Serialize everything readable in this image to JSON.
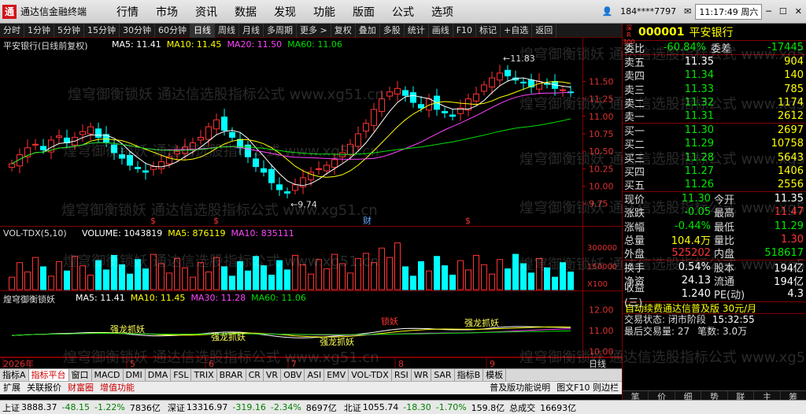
{
  "titlebar": {
    "logo": "通",
    "app_name": "通达信金融终端",
    "menus": [
      "行情",
      "市场",
      "资讯",
      "数据",
      "发现",
      "功能",
      "版面",
      "公式",
      "选项"
    ],
    "user": "184****7797",
    "clock": "11:17:49 周六"
  },
  "toolbar": {
    "items": [
      "分时",
      "1分钟",
      "5分钟",
      "15分钟",
      "30分钟",
      "60分钟",
      "日线",
      "周线",
      "月线",
      "多周期",
      "更多 >",
      "复权",
      "叠加",
      "多股",
      "统计",
      "画线",
      "F10",
      "标记",
      "+自选",
      "返回"
    ],
    "active": "日线"
  },
  "chart": {
    "title": "平安银行(日线前复权)",
    "ma_labels": [
      {
        "text": "MA5: 11.41",
        "color": "#ffffff"
      },
      {
        "text": "MA10: 11.45",
        "color": "#ffff00"
      },
      {
        "text": "MA20: 11.50",
        "color": "#ff44ff"
      },
      {
        "text": "MA60: 11.06",
        "color": "#00dd00"
      }
    ],
    "high_label": "11.83",
    "low_label": "9.74",
    "price_ticks": [
      "11.50",
      "11.25",
      "11.00",
      "10.75",
      "10.50",
      "10.25",
      "10.00",
      "9.75"
    ],
    "events": [
      "$",
      "$",
      "财",
      "$"
    ],
    "vol_title": "VOL-TDX(5,10)",
    "vol_labels": [
      {
        "text": "VOLUME: 1043819",
        "color": "#ffffff"
      },
      {
        "text": "MA5: 876119",
        "color": "#ffff00"
      },
      {
        "text": "MA10: 835111",
        "color": "#ff44ff"
      }
    ],
    "vol_ticks": [
      "300000",
      "150000",
      "X100"
    ],
    "ind_title": "煌穹御衡锁妖",
    "ind_labels": [
      {
        "text": "MA5: 11.41",
        "color": "#ffffff"
      },
      {
        "text": "MA10: 11.45",
        "color": "#ffff00"
      },
      {
        "text": "MA30: 11.28",
        "color": "#ff44ff"
      },
      {
        "text": "MA60: 11.06",
        "color": "#00dd00"
      }
    ],
    "ind_ticks": [
      "12.00",
      "11.00",
      "10.00"
    ],
    "signals": [
      {
        "text": "强龙抓妖",
        "color": "#ffff55"
      },
      {
        "text": "强龙抓妖",
        "color": "#ffff55"
      },
      {
        "text": "强龙抓妖",
        "color": "#ffff55"
      },
      {
        "text": "锁妖",
        "color": "#ff3333"
      },
      {
        "text": "强龙抓妖",
        "color": "#ffff55"
      }
    ],
    "dates": [
      "2026年",
      "5",
      "6",
      "7",
      "8",
      "9"
    ],
    "date_right": "日线"
  },
  "chart_data": {
    "type": "candlestick",
    "title": "平安银行(日线前复权)",
    "ylim": [
      9.6,
      11.9
    ],
    "high": 11.83,
    "low": 9.74,
    "close_path": [
      10.32,
      10.45,
      10.55,
      10.6,
      10.52,
      10.66,
      10.72,
      10.62,
      10.7,
      10.78,
      10.85,
      10.7,
      10.62,
      10.48,
      10.4,
      10.3,
      10.25,
      10.2,
      10.28,
      10.35,
      10.42,
      10.5,
      10.56,
      10.62,
      10.7,
      10.85,
      10.95,
      10.8,
      10.7,
      10.55,
      10.42,
      10.28,
      10.2,
      10.05,
      9.95,
      9.9,
      10.02,
      10.12,
      10.2,
      10.25,
      10.3,
      10.38,
      10.48,
      10.6,
      10.75,
      10.9,
      11.1,
      11.25,
      11.35,
      11.4,
      11.3,
      11.2,
      11.12,
      11.25,
      11.1,
      11.05,
      11.0,
      11.12,
      11.25,
      11.32,
      11.45,
      11.55,
      11.62,
      11.58,
      11.52,
      11.48,
      11.42,
      11.5,
      11.46,
      11.4,
      11.38,
      11.35
    ],
    "ma5": 11.41,
    "ma10": 11.45,
    "ma20": 11.5,
    "ma60": 11.06,
    "volume": 1043819,
    "vol_ma5": 876119,
    "vol_ma10": 835111
  },
  "quote": {
    "market": [
      "深",
      "R",
      "300"
    ],
    "code": "000001",
    "name": "平安银行",
    "ratio": {
      "label": "委比",
      "pct": "-60.84%",
      "diff_label": "委差",
      "diff": "-17445"
    },
    "asks": [
      {
        "label": "卖五",
        "price": "11.35",
        "vol": "904",
        "pcolor": "white"
      },
      {
        "label": "卖四",
        "price": "11.34",
        "vol": "140",
        "pcolor": "green"
      },
      {
        "label": "卖三",
        "price": "11.33",
        "vol": "785",
        "pcolor": "green"
      },
      {
        "label": "卖二",
        "price": "11.32",
        "vol": "1174",
        "pcolor": "green"
      },
      {
        "label": "卖一",
        "price": "11.31",
        "vol": "2612",
        "pcolor": "green"
      }
    ],
    "bids": [
      {
        "label": "买一",
        "price": "11.30",
        "vol": "2697",
        "pcolor": "green"
      },
      {
        "label": "买二",
        "price": "11.29",
        "vol": "10758",
        "pcolor": "green"
      },
      {
        "label": "买三",
        "price": "11.28",
        "vol": "5643",
        "pcolor": "green"
      },
      {
        "label": "买四",
        "price": "11.27",
        "vol": "1406",
        "pcolor": "green"
      },
      {
        "label": "买五",
        "price": "11.26",
        "vol": "2556",
        "pcolor": "green"
      }
    ],
    "stats": [
      {
        "l1": "现价",
        "v1": "11.30",
        "c1": "green",
        "l2": "今开",
        "v2": "11.35",
        "c2": "white"
      },
      {
        "l1": "涨跌",
        "v1": "-0.05",
        "c1": "green",
        "l2": "最高",
        "v2": "11.47",
        "c2": "red"
      },
      {
        "l1": "涨幅",
        "v1": "-0.44%",
        "c1": "green",
        "l2": "最低",
        "v2": "11.29",
        "c2": "green"
      },
      {
        "l1": "总量",
        "v1": "104.4万",
        "c1": "yellow",
        "l2": "量比",
        "v2": "1.30",
        "c2": "red"
      },
      {
        "l1": "外盘",
        "v1": "525202",
        "c1": "red",
        "l2": "内盘",
        "v2": "518617",
        "c2": "green"
      }
    ],
    "stats2": [
      {
        "l1": "换手",
        "v1": "0.54%",
        "c1": "white",
        "l2": "股本",
        "v2": "194亿",
        "c2": "white"
      },
      {
        "l1": "净资",
        "v1": "24.13",
        "c1": "white",
        "l2": "流通",
        "v2": "194亿",
        "c2": "white"
      },
      {
        "l1": "收益(三)",
        "v1": "1.240",
        "c1": "white",
        "l2": "PE(动)",
        "v2": "4.3",
        "c2": "white"
      }
    ],
    "ad": "自动续费通达信普及版 30元/月",
    "trade_status": "交易状态: 闭市阶段",
    "trade_time": "15:32:55",
    "last_trade": "最后交易量: 27",
    "total_trades": "笔数: 3.0万",
    "tabs": [
      "笔",
      "价",
      "细",
      "势",
      "联",
      "主",
      "筹"
    ]
  },
  "bottom": {
    "ind_tabs": [
      "指标A",
      "指标平台",
      "窗口",
      "MACD",
      "DMI",
      "DMA",
      "FSL",
      "TRIX",
      "BRAR",
      "CR",
      "VR",
      "OBV",
      "ASI",
      "EMV",
      "VOL-TDX",
      "RSI",
      "WR",
      "SAR",
      "指标B",
      "模板"
    ],
    "ind_active": "指标平台",
    "ext": [
      "扩展",
      "关联报价",
      "财富圈",
      "增值功能"
    ],
    "ext_right": [
      "普及版功能说明",
      "图文F10 则边栏"
    ],
    "status": [
      {
        "label": "上证",
        "v": "3888.37",
        "c": "#000"
      },
      {
        "label": "",
        "v": "-48.15",
        "c": "#008000"
      },
      {
        "label": "",
        "v": "-1.22%",
        "c": "#008000"
      },
      {
        "label": "",
        "v": "7836亿",
        "c": "#000"
      },
      {
        "label": "深证",
        "v": "13316.97",
        "c": "#000"
      },
      {
        "label": "",
        "v": "-319.16",
        "c": "#008000"
      },
      {
        "label": "",
        "v": "-2.34%",
        "c": "#008000"
      },
      {
        "label": "",
        "v": "8697亿",
        "c": "#000"
      },
      {
        "label": "北证",
        "v": "1055.74",
        "c": "#000"
      },
      {
        "label": "",
        "v": "-18.30",
        "c": "#008000"
      },
      {
        "label": "",
        "v": "-1.70%",
        "c": "#008000"
      },
      {
        "label": "",
        "v": "159.8亿",
        "c": "#000"
      },
      {
        "label": "",
        "v": "总成交",
        "c": "#000"
      },
      {
        "label": "",
        "v": "16693亿",
        "c": "#000"
      }
    ]
  },
  "watermark": "煌穹御衡锁妖 通达信选股指标公式 www.xg51.cn"
}
